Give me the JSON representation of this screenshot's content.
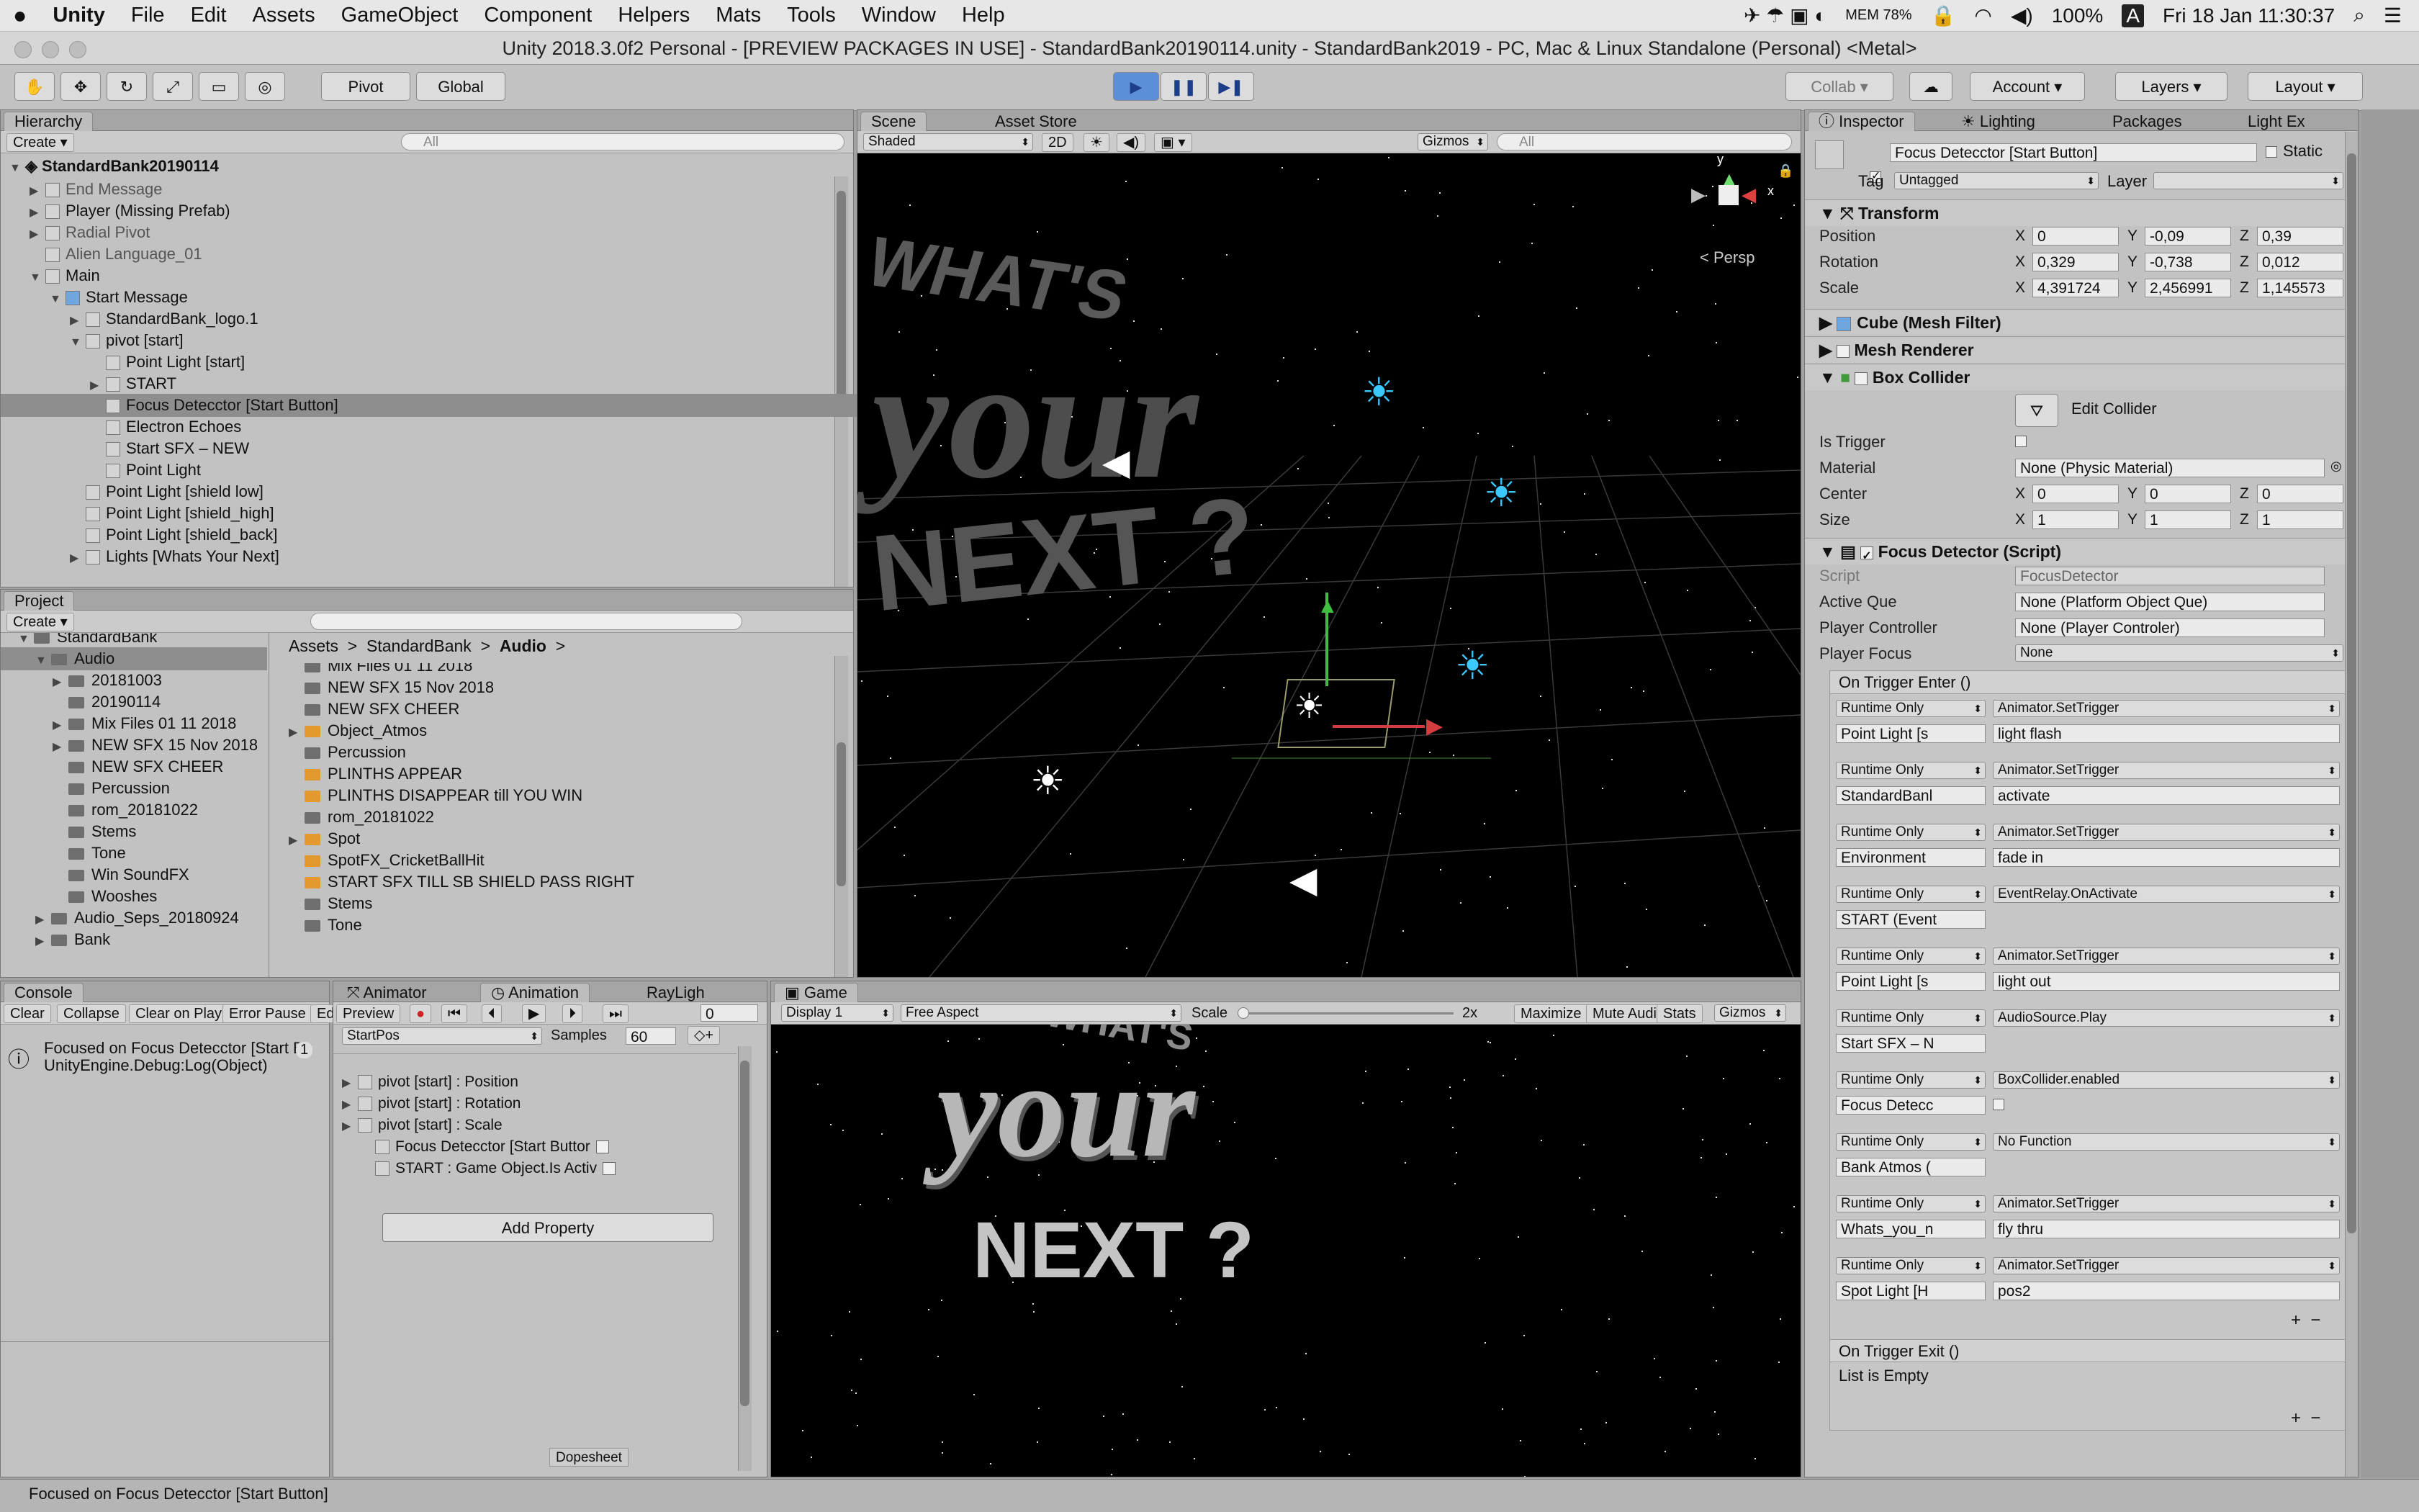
{
  "menubar": {
    "app": "Unity",
    "items": [
      "File",
      "Edit",
      "Assets",
      "GameObject",
      "Component",
      "Helpers",
      "Mats",
      "Tools",
      "Window",
      "Help"
    ],
    "battery": "100%",
    "mem": "MEM 78%",
    "datetime": "Fri 18 Jan  11:30:37",
    "user_initial": "A"
  },
  "window_title": "Unity 2018.3.0f2 Personal - [PREVIEW PACKAGES IN USE] - StandardBank20190114.unity - StandardBank2019 - PC, Mac & Linux Standalone (Personal) <Metal>",
  "toolbar": {
    "pivot": "Pivot",
    "global": "Global",
    "collab": "Collab",
    "account": "Account",
    "layers": "Layers",
    "layout": "Layout"
  },
  "hierarchy": {
    "tab": "Hierarchy",
    "create": "Create",
    "search_placeholder": "All",
    "scene": "StandardBank20190114",
    "items": [
      {
        "label": "End Message",
        "indent": 1,
        "arrow": "▶",
        "dim": true
      },
      {
        "label": "Player (Missing Prefab)",
        "indent": 1,
        "arrow": "▶"
      },
      {
        "label": "Radial Pivot",
        "indent": 1,
        "arrow": "▶",
        "dim": true
      },
      {
        "label": "Alien Language_01",
        "indent": 1,
        "arrow": "",
        "dim": true
      },
      {
        "label": "Main",
        "indent": 1,
        "arrow": "▼"
      },
      {
        "label": "Start Message",
        "indent": 2,
        "arrow": "▼",
        "blue": true
      },
      {
        "label": "StandardBank_logo.1",
        "indent": 3,
        "arrow": "▶"
      },
      {
        "label": "pivot [start]",
        "indent": 3,
        "arrow": "▼"
      },
      {
        "label": "Point Light [start]",
        "indent": 4,
        "arrow": ""
      },
      {
        "label": "START",
        "indent": 4,
        "arrow": "▶"
      },
      {
        "label": "Focus Detecctor [Start Button]",
        "indent": 4,
        "arrow": "",
        "selected": true
      },
      {
        "label": "Electron Echoes",
        "indent": 4,
        "arrow": ""
      },
      {
        "label": "Start SFX – NEW",
        "indent": 4,
        "arrow": ""
      },
      {
        "label": "Point Light",
        "indent": 4,
        "arrow": ""
      },
      {
        "label": "Point Light [shield low]",
        "indent": 3,
        "arrow": ""
      },
      {
        "label": "Point Light [shield_high]",
        "indent": 3,
        "arrow": ""
      },
      {
        "label": "Point Light [shield_back]",
        "indent": 3,
        "arrow": ""
      },
      {
        "label": "Lights [Whats Your Next]",
        "indent": 3,
        "arrow": "▶"
      }
    ]
  },
  "project": {
    "tab": "Project",
    "create": "Create",
    "tree": [
      {
        "label": "StandardBank",
        "indent": 1,
        "arrow": "▼"
      },
      {
        "label": "Audio",
        "indent": 2,
        "arrow": "▼",
        "selected": true
      },
      {
        "label": "20181003",
        "indent": 3,
        "arrow": "▶"
      },
      {
        "label": "20190114",
        "indent": 3,
        "arrow": ""
      },
      {
        "label": "Mix Files 01 11 2018",
        "indent": 3,
        "arrow": "▶"
      },
      {
        "label": "NEW SFX  15 Nov 2018",
        "indent": 3,
        "arrow": "▶"
      },
      {
        "label": "NEW SFX CHEER",
        "indent": 3,
        "arrow": ""
      },
      {
        "label": "Percussion",
        "indent": 3,
        "arrow": ""
      },
      {
        "label": "rom_20181022",
        "indent": 3,
        "arrow": ""
      },
      {
        "label": "Stems",
        "indent": 3,
        "arrow": ""
      },
      {
        "label": "Tone",
        "indent": 3,
        "arrow": ""
      },
      {
        "label": "Win SoundFX",
        "indent": 3,
        "arrow": ""
      },
      {
        "label": "Wooshes",
        "indent": 3,
        "arrow": ""
      },
      {
        "label": "Audio_Seps_20180924",
        "indent": 2,
        "arrow": "▶"
      },
      {
        "label": "Bank",
        "indent": 2,
        "arrow": "▶"
      }
    ],
    "breadcrumb": [
      "Assets",
      "StandardBank",
      "Audio"
    ],
    "files": [
      {
        "label": "Mix Files 01 11 2018",
        "type": "folder"
      },
      {
        "label": "NEW SFX  15 Nov 2018",
        "type": "folder"
      },
      {
        "label": "NEW SFX CHEER",
        "type": "folder"
      },
      {
        "label": "Object_Atmos",
        "type": "audio",
        "arrow": "▶"
      },
      {
        "label": "Percussion",
        "type": "folder"
      },
      {
        "label": "PLINTHS APPEAR",
        "type": "audio"
      },
      {
        "label": "PLINTHS DISAPPEAR  till  YOU WIN",
        "type": "audio"
      },
      {
        "label": "rom_20181022",
        "type": "folder"
      },
      {
        "label": "Spot",
        "type": "audio",
        "arrow": "▶"
      },
      {
        "label": "SpotFX_CricketBallHit",
        "type": "audio"
      },
      {
        "label": "START SFX  TILL SB SHIELD PASS RIGHT",
        "type": "audio"
      },
      {
        "label": "Stems",
        "type": "folder"
      },
      {
        "label": "Tone",
        "type": "folder"
      }
    ]
  },
  "scene": {
    "tab": "Scene",
    "tab2": "Asset Store",
    "shaded": "Shaded",
    "mode2d": "2D",
    "gizmos": "Gizmos",
    "search_placeholder": "All",
    "persp": "< Persp",
    "text1": "WHAT'S",
    "text2": "your",
    "text3": "NEXT ?",
    "axis_x": "x",
    "axis_y": "y"
  },
  "console": {
    "tab": "Console",
    "buttons": [
      "Clear",
      "Collapse",
      "Clear on Play",
      "Error Pause",
      "Ed"
    ],
    "message1": "Focused on Focus Detecctor [Start Bu",
    "message2": "UnityEngine.Debug:Log(Object)",
    "count": "1"
  },
  "animation": {
    "tab1": "Animator",
    "tab2": "Animation",
    "tab3": "RayLigh",
    "preview": "Preview",
    "frame": "0",
    "clip": "StartPos",
    "samples_label": "Samples",
    "samples": "60",
    "properties": [
      "pivot [start] : Position",
      "pivot [start] : Rotation",
      "pivot [start] : Scale",
      "Focus Detecctor [Start Buttor",
      "START : Game Object.Is Activ"
    ],
    "add_property": "Add Property",
    "dopesheet": "Dopesheet"
  },
  "game": {
    "tab": "Game",
    "display": "Display 1",
    "aspect": "Free Aspect",
    "scale_label": "Scale",
    "scale_value": "2x",
    "maximize": "Maximize On Play",
    "mute": "Mute Audio",
    "stats": "Stats",
    "gizmos": "Gizmos",
    "text1": "WHAT'S",
    "text2": "your",
    "text3": "NEXT ?"
  },
  "inspector": {
    "tabs": [
      "Inspector",
      "Lighting",
      "Packages",
      "Light Ex"
    ],
    "object_name": "Focus Detecctor [Start Button]",
    "static": "Static",
    "tag_label": "Tag",
    "tag": "Untagged",
    "layer_label": "Layer",
    "transform": {
      "title": "Transform",
      "rows": [
        {
          "label": "Position",
          "x": "0",
          "y": "-0,09",
          "z": "0,39"
        },
        {
          "label": "Rotation",
          "x": "0,329",
          "y": "-0,738",
          "z": "0,012"
        },
        {
          "label": "Scale",
          "x": "4,391724",
          "y": "2,456991",
          "z": "1,145573"
        }
      ]
    },
    "mesh_filter": "Cube (Mesh Filter)",
    "mesh_renderer": "Mesh Renderer",
    "box_collider": {
      "title": "Box Collider",
      "edit": "Edit Collider",
      "is_trigger": "Is Trigger",
      "material_label": "Material",
      "material": "None (Physic Material)",
      "center_label": "Center",
      "center": {
        "x": "0",
        "y": "0",
        "z": "0"
      },
      "size_label": "Size",
      "size": {
        "x": "1",
        "y": "1",
        "z": "1"
      }
    },
    "focus_detector": {
      "title": "Focus Detector (Script)",
      "script_label": "Script",
      "script": "FocusDetector",
      "active_que_label": "Active Que",
      "active_que": "None (Platform Object Que)",
      "player_controller_label": "Player Controller",
      "player_controller": "None (Player Controler)",
      "player_focus_label": "Player Focus",
      "player_focus": "None",
      "on_enter": "On Trigger Enter ()",
      "events": [
        {
          "mode": "Runtime Only",
          "fn": "Animator.SetTrigger",
          "obj": "Point Light [s",
          "arg": "light flash"
        },
        {
          "mode": "Runtime Only",
          "fn": "Animator.SetTrigger",
          "obj": "StandardBanl",
          "arg": "activate"
        },
        {
          "mode": "Runtime Only",
          "fn": "Animator.SetTrigger",
          "obj": "Environment",
          "arg": "fade in"
        },
        {
          "mode": "Runtime Only",
          "fn": "EventRelay.OnActivate",
          "obj": "START (Event",
          "arg": ""
        },
        {
          "mode": "Runtime Only",
          "fn": "Animator.SetTrigger",
          "obj": "Point Light [s",
          "arg": "light out"
        },
        {
          "mode": "Runtime Only",
          "fn": "AudioSource.Play",
          "obj": "Start SFX – N",
          "arg": ""
        },
        {
          "mode": "Runtime Only",
          "fn": "BoxCollider.enabled",
          "obj": "Focus Detecc",
          "arg": ""
        },
        {
          "mode": "Runtime Only",
          "fn": "No Function",
          "obj": "Bank Atmos (",
          "arg": ""
        },
        {
          "mode": "Runtime Only",
          "fn": "Animator.SetTrigger",
          "obj": "Whats_you_n",
          "arg": "fly thru"
        },
        {
          "mode": "Runtime Only",
          "fn": "Animator.SetTrigger",
          "obj": "Spot Light [H",
          "arg": "pos2"
        }
      ],
      "on_exit": "On Trigger Exit ()",
      "list_empty": "List is Empty"
    }
  },
  "status": "Focused on Focus Detecctor [Start Button]"
}
